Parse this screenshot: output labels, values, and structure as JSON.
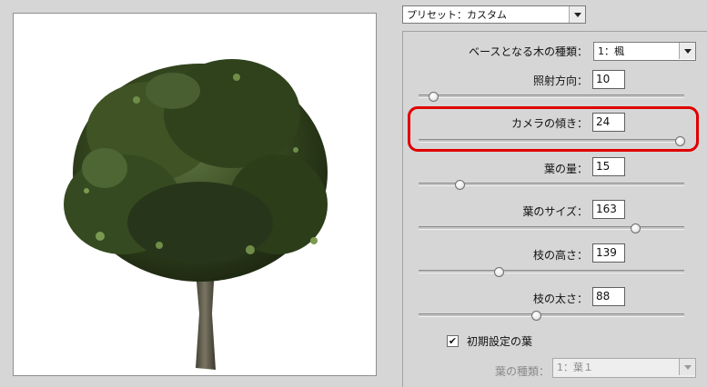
{
  "preset": {
    "label": "プリセット：カスタム"
  },
  "base_tree": {
    "label": "ベースとなる木の種類：",
    "value": "1：楓"
  },
  "sliders": [
    {
      "label": "照射方向：",
      "value": "10",
      "thumb_fraction": 0.05
    },
    {
      "label": "カメラの傾き：",
      "value": "24",
      "thumb_fraction": 0.99
    },
    {
      "label": "葉の量：",
      "value": "15",
      "thumb_fraction": 0.15
    },
    {
      "label": "葉のサイズ：",
      "value": "163",
      "thumb_fraction": 0.82
    },
    {
      "label": "枝の高さ：",
      "value": "139",
      "thumb_fraction": 0.3
    },
    {
      "label": "枝の太さ：",
      "value": "88",
      "thumb_fraction": 0.44
    }
  ],
  "default_leaves": {
    "label": "初期設定の葉",
    "checked": true,
    "check_mark": "✔"
  },
  "leaf_type": {
    "label": "葉の種類：",
    "value": "1：葉１"
  },
  "colors": {
    "highlight": "#e00000",
    "background": "#d6d6d6",
    "tree_foliage": "#3a4d27",
    "tree_trunk": "#5a5645"
  }
}
